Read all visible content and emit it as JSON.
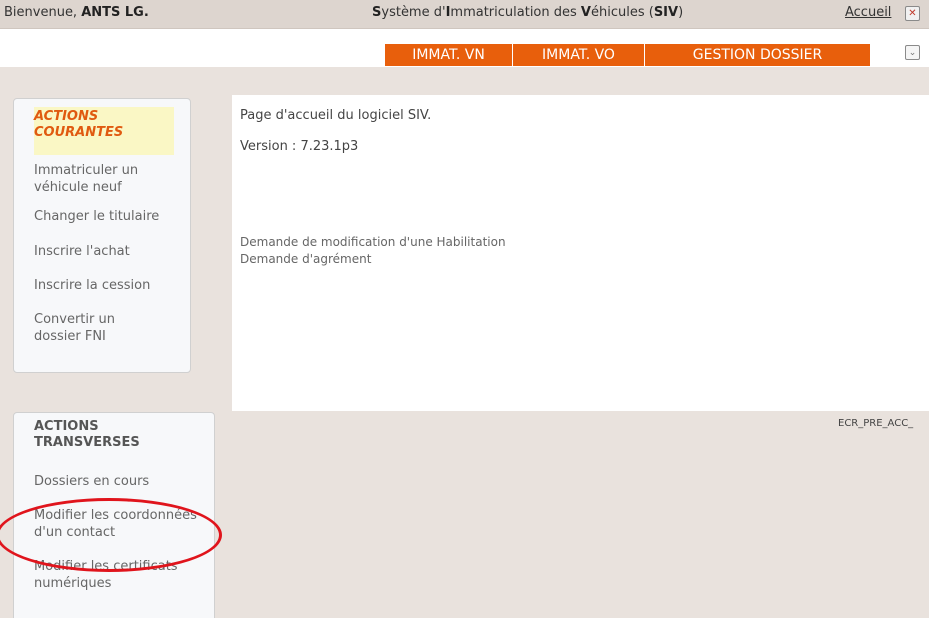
{
  "header": {
    "welcome_prefix": "Bienvenue, ",
    "user_name": "ANTS LG.",
    "title_parts": [
      {
        "bold": true,
        "text": "S"
      },
      {
        "bold": false,
        "text": "ystème d'"
      },
      {
        "bold": true,
        "text": "I"
      },
      {
        "bold": false,
        "text": "mmatriculation des "
      },
      {
        "bold": true,
        "text": "V"
      },
      {
        "bold": false,
        "text": "éhicules ("
      },
      {
        "bold": true,
        "text": "SIV"
      },
      {
        "bold": false,
        "text": ")"
      }
    ],
    "home_label": "Accueil",
    "close_icon": "close-icon"
  },
  "tabs": [
    "IMMAT. VN",
    "IMMAT. VO",
    "GESTION DOSSIER"
  ],
  "sidebar": {
    "current_actions": {
      "title_line1": "ACTIONS",
      "title_line2": "COURANTES",
      "items": [
        {
          "line1": "Immatriculer un",
          "line2": "véhicule neuf"
        },
        {
          "line1": "Changer le titulaire",
          "line2": ""
        },
        {
          "line1": "Inscrire l'achat",
          "line2": ""
        },
        {
          "line1": "Inscrire la cession",
          "line2": ""
        },
        {
          "line1": "Convertir un",
          "line2": "dossier FNI"
        }
      ]
    },
    "transverse_actions": {
      "title_line1": "ACTIONS",
      "title_line2": "TRANSVERSES",
      "items": [
        {
          "line1": "Dossiers en cours",
          "line2": ""
        },
        {
          "line1": "Modifier les coordonnées",
          "line2": "d'un contact"
        },
        {
          "line1": "Modifier les certificats",
          "line2": "numériques"
        }
      ]
    }
  },
  "main": {
    "welcome_text": "Page d'accueil du logiciel SIV.",
    "version_text": "Version : 7.23.1p3",
    "links": [
      "Demande de modification d'une Habilitation",
      "Demande d'agrément"
    ]
  },
  "screen_code": "ECR_PRE_ACC_",
  "colors": {
    "accent": "#e85f0c",
    "annotation": "#e0141c",
    "highlight_bg": "#faf7c5"
  }
}
